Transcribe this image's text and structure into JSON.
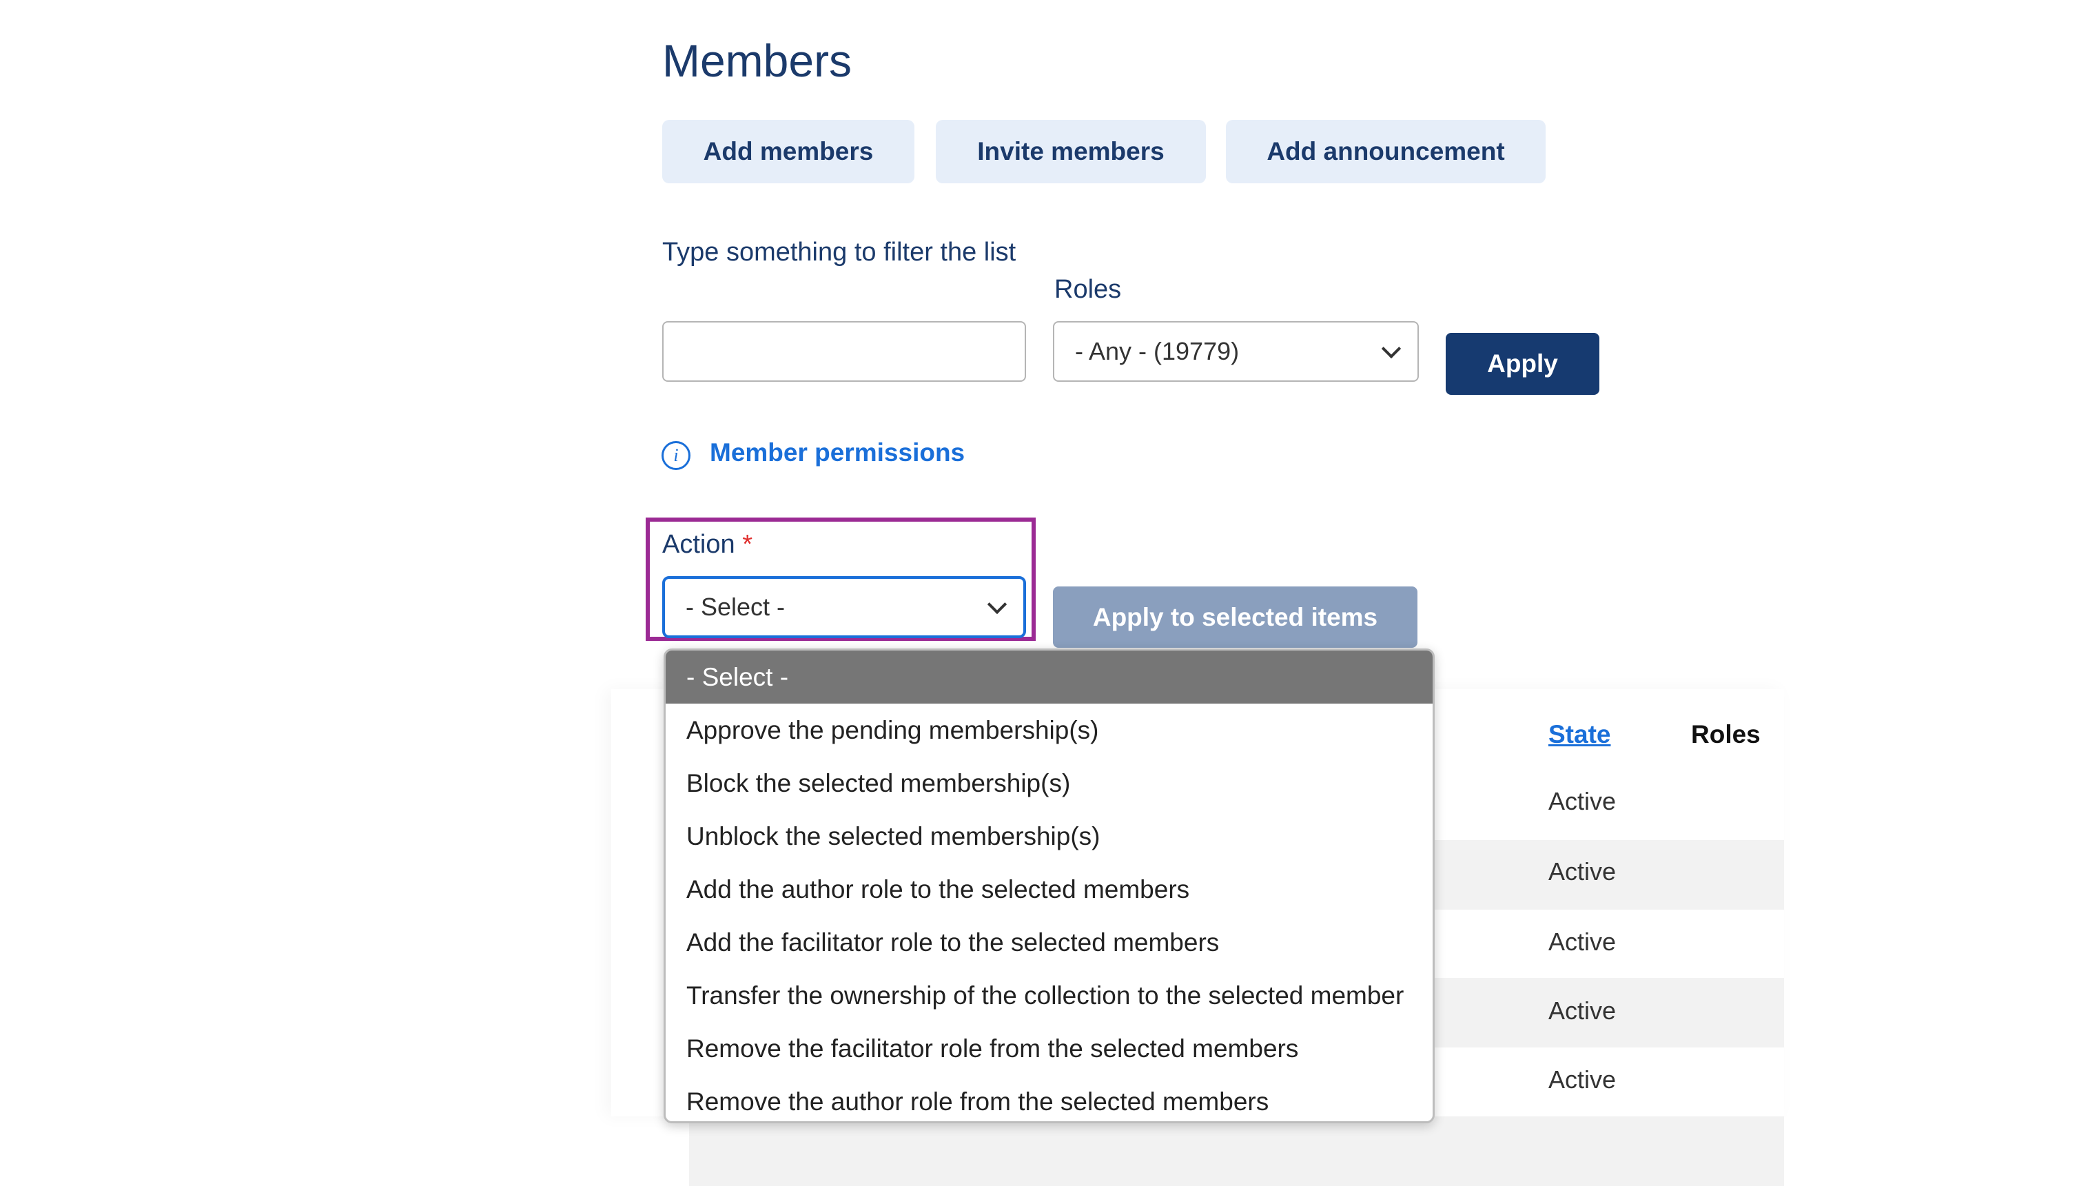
{
  "page_title": "Members",
  "toolbar": {
    "add_members": "Add members",
    "invite_members": "Invite members",
    "add_announcement": "Add announcement"
  },
  "filter": {
    "text_label": "Type something to filter the list",
    "text_value": "",
    "roles_label": "Roles",
    "roles_value": "- Any - (19779)",
    "apply_label": "Apply"
  },
  "permissions_link": "Member permissions",
  "action": {
    "label": "Action",
    "required_mark": "*",
    "value": "- Select -",
    "apply_selected_label": "Apply to selected items",
    "options": [
      "- Select -",
      "Approve the pending membership(s)",
      "Block the selected membership(s)",
      "Unblock the selected membership(s)",
      "Add the author role to the selected members",
      "Add the facilitator role to the selected members",
      "Transfer the ownership of the collection to the selected member",
      "Remove the facilitator role from the selected members",
      "Remove the author role from the selected members"
    ]
  },
  "table": {
    "headers": {
      "state": "State",
      "roles": "Roles"
    },
    "rows": [
      {
        "state": "Active"
      },
      {
        "state": "Active"
      },
      {
        "state": "Active"
      },
      {
        "state": "Active"
      },
      {
        "state": "Active"
      }
    ]
  },
  "colors": {
    "primary": "#163a70",
    "link": "#1a6fd9",
    "highlight": "#9b2a94",
    "required": "#e0302f"
  }
}
